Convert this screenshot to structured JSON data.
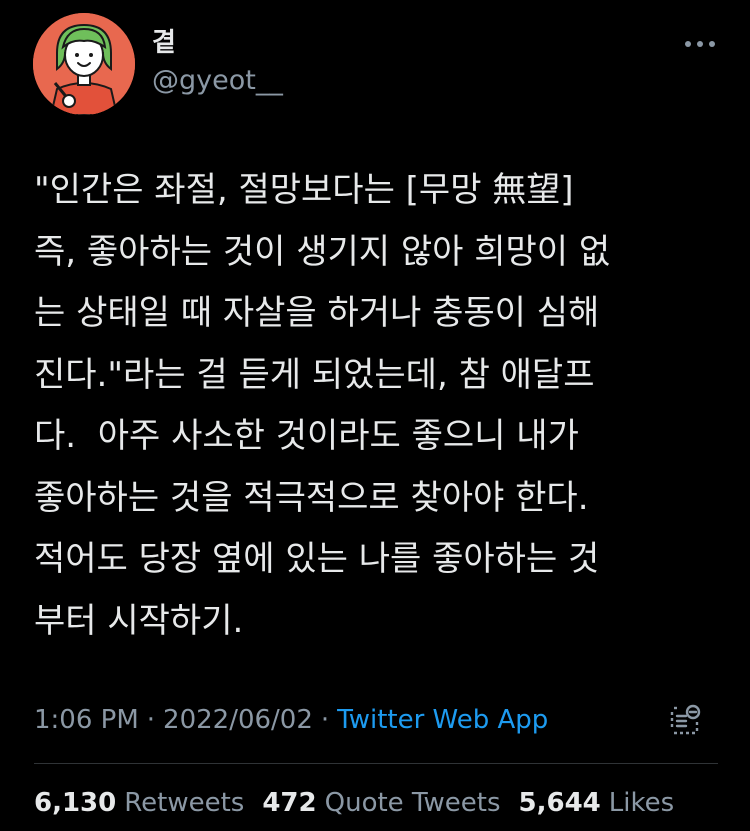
{
  "author": {
    "display_name": "곁",
    "handle": "@gyeot__",
    "avatar_icon": "illustrated-person-avatar",
    "avatar_bg": "#e8684f"
  },
  "tweet": {
    "text": "\"인간은 좌절, 절망보다는 [무망 無望]\n즉, 좋아하는 것이 생기지 않아 희망이 없\n는 상태일 때 자살을 하거나 충동이 심해\n진다.\"라는 걸 듣게 되었는데, 참 애달프\n다.  아주 사소한 것이라도 좋으니 내가\n좋아하는 것을 적극적으로 찾아야 한다.\n적어도 당장 옆에 있는 나를 좋아하는 것\n부터 시작하기."
  },
  "meta": {
    "time": "1:06 PM",
    "separator": "·",
    "date": "2022/06/02",
    "source": "Twitter Web App"
  },
  "stats": {
    "retweets_count": "6,130",
    "retweets_label": "Retweets",
    "quotes_count": "472",
    "quotes_label": "Quote Tweets",
    "likes_count": "5,644",
    "likes_label": "Likes"
  },
  "icons": {
    "more": "more-horizontal-icon",
    "analytics": "analytics-icon"
  },
  "colors": {
    "background": "#000000",
    "primary_text": "#e7e9ea",
    "secondary_text": "#8b98a5",
    "link": "#1d9bf0",
    "divider": "#2f3336"
  }
}
